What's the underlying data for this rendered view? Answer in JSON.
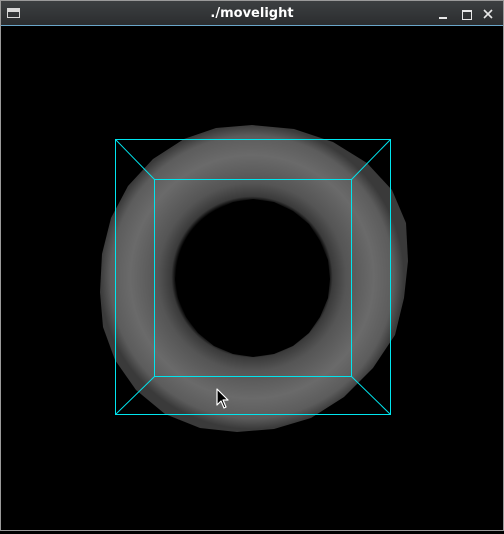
{
  "window": {
    "title": "./movelight",
    "controls": {
      "minimize": "minimize",
      "maximize": "maximize",
      "close": "close"
    }
  },
  "scene": {
    "background": "#000000",
    "torus_color": "#6a6a6a",
    "cube_edge_color": "#00e5ee"
  },
  "icons": {
    "app": "window-icon",
    "minimize": "minimize-icon",
    "maximize": "maximize-icon",
    "close": "close-icon",
    "cursor": "mouse-pointer-icon"
  }
}
